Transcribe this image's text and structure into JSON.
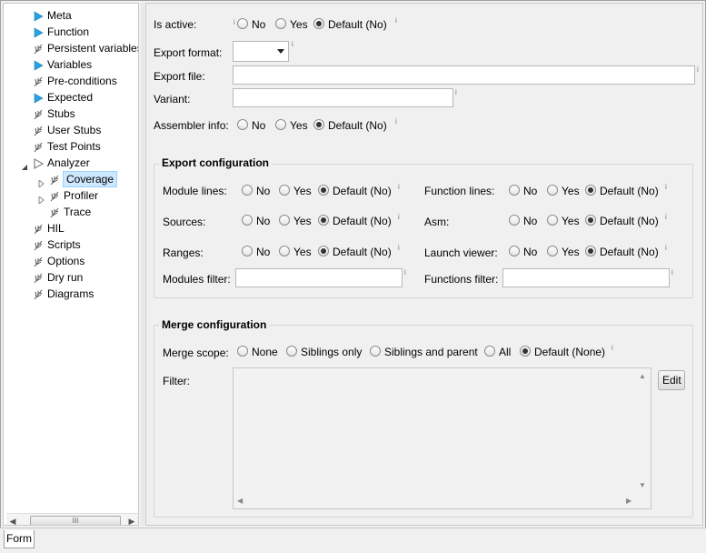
{
  "tree": {
    "items": [
      {
        "label": "Meta",
        "icon": "triangle-icon",
        "expander": ""
      },
      {
        "label": "Function",
        "icon": "triangle-icon",
        "expander": ""
      },
      {
        "label": "Persistent variables",
        "icon": "feather-icon",
        "expander": ""
      },
      {
        "label": "Variables",
        "icon": "triangle-icon",
        "expander": ""
      },
      {
        "label": "Pre-conditions",
        "icon": "feather-icon",
        "expander": ""
      },
      {
        "label": "Expected",
        "icon": "triangle-icon",
        "expander": ""
      },
      {
        "label": "Stubs",
        "icon": "feather-icon",
        "expander": ""
      },
      {
        "label": "User Stubs",
        "icon": "feather-icon",
        "expander": ""
      },
      {
        "label": "Test Points",
        "icon": "feather-icon",
        "expander": ""
      },
      {
        "label": "Analyzer",
        "icon": "triangle-outline-icon",
        "expander": "expanded"
      },
      {
        "label": "Coverage",
        "icon": "feather-icon",
        "expander": "collapsed"
      },
      {
        "label": "Profiler",
        "icon": "feather-icon",
        "expander": "collapsed"
      },
      {
        "label": "Trace",
        "icon": "feather-icon",
        "expander": ""
      },
      {
        "label": "HIL",
        "icon": "feather-icon",
        "expander": ""
      },
      {
        "label": "Scripts",
        "icon": "feather-icon",
        "expander": ""
      },
      {
        "label": "Options",
        "icon": "feather-icon",
        "expander": ""
      },
      {
        "label": "Dry run",
        "icon": "feather-icon",
        "expander": ""
      },
      {
        "label": "Diagrams",
        "icon": "feather-icon",
        "expander": ""
      }
    ],
    "selected": "Coverage",
    "scroll_thumb_grip": "III"
  },
  "form": {
    "is_active": {
      "label": "Is active:",
      "options": [
        "No",
        "Yes",
        "Default (No)"
      ],
      "selected": "Default (No)"
    },
    "export_format": {
      "label": "Export format:",
      "value": ""
    },
    "export_file": {
      "label": "Export file:",
      "value": ""
    },
    "variant": {
      "label": "Variant:",
      "value": ""
    },
    "assembler_info": {
      "label": "Assembler info:",
      "options": [
        "No",
        "Yes",
        "Default (No)"
      ],
      "selected": "Default (No)"
    },
    "info_glyph": "i"
  },
  "export_config": {
    "title": "Export configuration",
    "module_lines": {
      "label": "Module lines:",
      "options": [
        "No",
        "Yes",
        "Default (No)"
      ],
      "selected": "Default (No)"
    },
    "function_lines": {
      "label": "Function lines:",
      "options": [
        "No",
        "Yes",
        "Default (No)"
      ],
      "selected": "Default (No)"
    },
    "sources": {
      "label": "Sources:",
      "options": [
        "No",
        "Yes",
        "Default (No)"
      ],
      "selected": "Default (No)"
    },
    "asm": {
      "label": "Asm:",
      "options": [
        "No",
        "Yes",
        "Default (No)"
      ],
      "selected": "Default (No)"
    },
    "ranges": {
      "label": "Ranges:",
      "options": [
        "No",
        "Yes",
        "Default (No)"
      ],
      "selected": "Default (No)"
    },
    "launch_viewer": {
      "label": "Launch viewer:",
      "options": [
        "No",
        "Yes",
        "Default (No)"
      ],
      "selected": "Default (No)"
    },
    "modules_filter": {
      "label": "Modules filter:",
      "value": ""
    },
    "functions_filter": {
      "label": "Functions filter:",
      "value": ""
    }
  },
  "merge_config": {
    "title": "Merge configuration",
    "merge_scope": {
      "label": "Merge scope:",
      "options": [
        "None",
        "Siblings only",
        "Siblings and parent",
        "All",
        "Default (None)"
      ],
      "selected": "Default (None)"
    },
    "filter": {
      "label": "Filter:",
      "value": ""
    },
    "edit_button": "Edit"
  },
  "tabs": {
    "form": "Form"
  },
  "colors": {
    "triangle_icon": "#29a3e0",
    "selection": "#cde8ff"
  }
}
